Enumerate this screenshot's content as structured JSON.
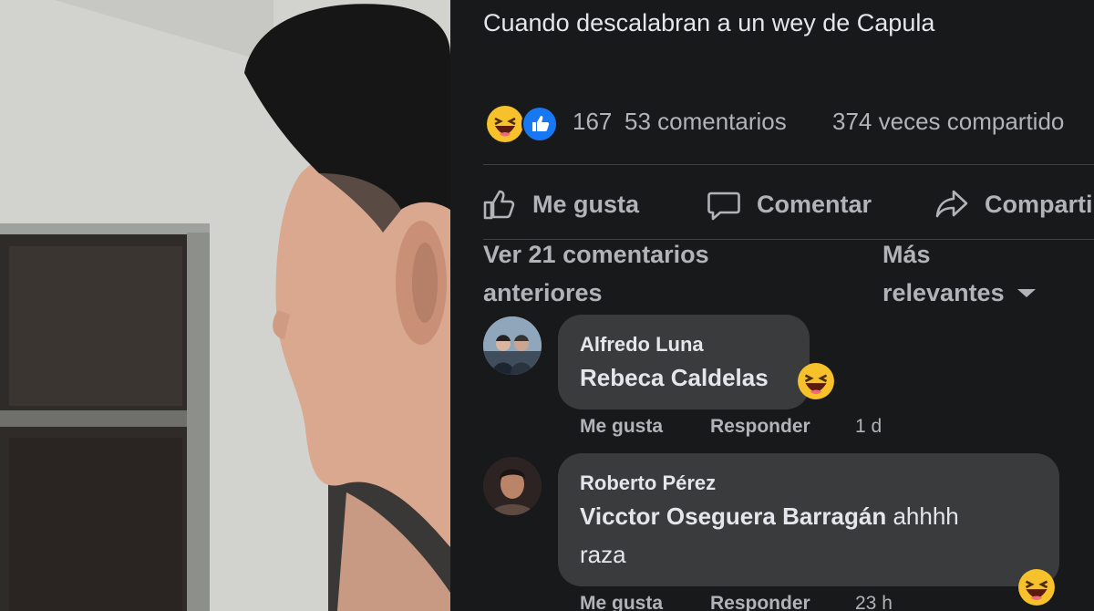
{
  "post": {
    "caption": "Cuando descalabran a un wey de Capula",
    "reactions_count": "167",
    "comments_count": "53 comentarios",
    "shares_count": "374 veces compartido",
    "reaction_icons": [
      "haha-icon",
      "like-icon"
    ]
  },
  "actions": {
    "like": "Me gusta",
    "comment": "Comentar",
    "share": "Compartir"
  },
  "comments_header": {
    "view_previous": "Ver 21 comentarios anteriores",
    "sort_line1": "Más",
    "sort_line2": "relevantes"
  },
  "comments": [
    {
      "author": "Alfredo Luna",
      "mention": "Rebeca Caldelas",
      "text": "",
      "like_label": "Me gusta",
      "reply_label": "Responder",
      "time": "1 d"
    },
    {
      "author": "Roberto Pérez",
      "mention": "Vicctor Oseguera Barragán",
      "text": "ahhhh",
      "text_line2": "raza",
      "like_label": "Me gusta",
      "reply_label": "Responder",
      "time": "23 h"
    }
  ],
  "colors": {
    "background": "#18191a",
    "bubble": "#3a3b3c",
    "text_primary": "#e4e6eb",
    "text_secondary": "#b0b3b8",
    "like_blue": "#1877f2",
    "haha_yellow": "#f7c12b"
  }
}
